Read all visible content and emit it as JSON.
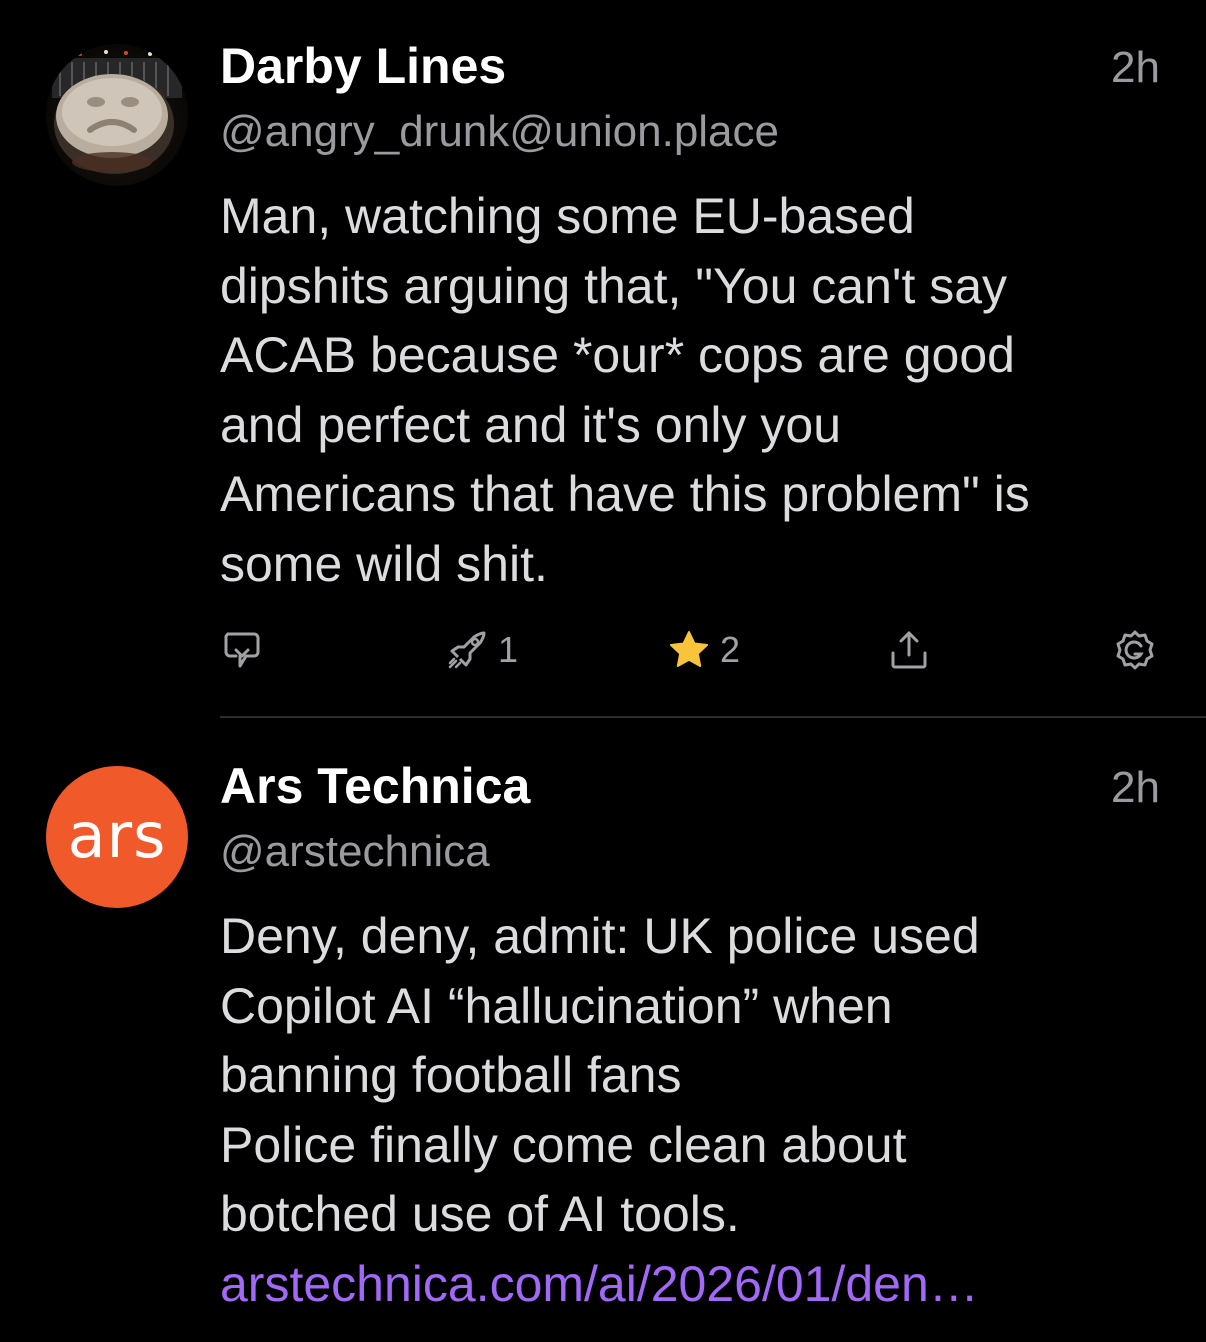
{
  "posts": [
    {
      "display_name": "Darby Lines",
      "handle": "@angry_drunk@union.place",
      "timestamp": "2h",
      "avatar_icon": "frowning-face-avatar",
      "content_lines": [
        "Man, watching some EU-based",
        "dipshits arguing that, \"You can't say",
        "ACAB because *our* cops are good",
        "and perfect and it's only you",
        "Americans that have this problem\" is",
        "some wild shit."
      ],
      "actions": {
        "reply_icon": "reply-icon",
        "boost_icon": "boost-icon",
        "boost_count": "1",
        "favorite_icon": "star-icon",
        "favorite_count": "2",
        "favorite_color": "#f9c43c",
        "share_icon": "share-icon",
        "more_icon": "gear-icon"
      }
    },
    {
      "display_name": "Ars Technica",
      "handle": "@arstechnica",
      "timestamp": "2h",
      "avatar_text": "ars",
      "avatar_color": "#f0592a",
      "content_lines": [
        "Deny, deny, admit: UK police used",
        "Copilot AI “hallucination” when",
        "banning football fans",
        "Police finally come clean about",
        "botched use of AI tools."
      ],
      "link": "arstechnica.com/ai/2026/01/den…",
      "link_color": "#a268f7"
    }
  ],
  "colors": {
    "background": "#000000",
    "secondary_text": "#9a9a9f",
    "body_text": "#dcdcdf",
    "divider": "#2c2c2e"
  }
}
